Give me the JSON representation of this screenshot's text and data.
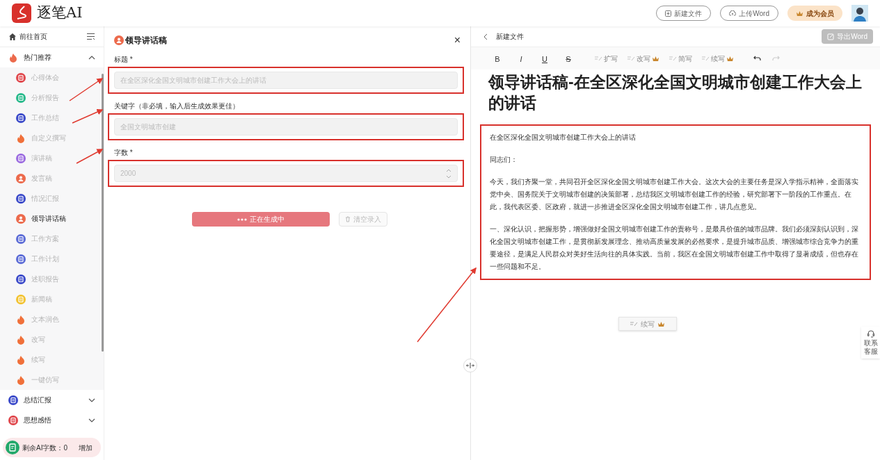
{
  "header": {
    "logo_text": "逐笔AI",
    "buttons": [
      {
        "kind": "new",
        "label": "新建文件"
      },
      {
        "kind": "upload",
        "label": "上传Word"
      }
    ],
    "member_button": "成为会员"
  },
  "sidebar": {
    "home": "前往首页",
    "groups": [
      {
        "label": "热门推荐",
        "kind": "hot",
        "color": "#ec6a4c",
        "expanded": true,
        "items": [
          {
            "label": "心得体会",
            "kind": "doc",
            "color": "#e0474c",
            "selected": false
          },
          {
            "label": "分析报告",
            "kind": "doc",
            "color": "#26b98a",
            "selected": false
          },
          {
            "label": "工作总结",
            "kind": "doc",
            "color": "#3a49c9",
            "selected": false
          },
          {
            "label": "自定义撰写",
            "kind": "hot",
            "color": "#f0703a",
            "selected": false
          },
          {
            "label": "演讲稿",
            "kind": "doc",
            "color": "#9b6be0",
            "selected": false
          },
          {
            "label": "发言稿",
            "kind": "person",
            "color": "#ec6a4c",
            "selected": false
          },
          {
            "label": "情况汇报",
            "kind": "doc",
            "color": "#3a49c9",
            "selected": false
          },
          {
            "label": "领导讲话稿",
            "kind": "person",
            "color": "#ec6a4c",
            "selected": true
          },
          {
            "label": "工作方案",
            "kind": "doc",
            "color": "#5b6bd6",
            "selected": false
          },
          {
            "label": "工作计划",
            "kind": "doc",
            "color": "#5b6bd6",
            "selected": false
          },
          {
            "label": "述职报告",
            "kind": "doc",
            "color": "#3a49c9",
            "selected": false
          },
          {
            "label": "新闻稿",
            "kind": "doc",
            "color": "#f2c230",
            "selected": false
          },
          {
            "label": "文本润色",
            "kind": "hot",
            "color": "#f0703a",
            "selected": false
          },
          {
            "label": "改写",
            "kind": "hot",
            "color": "#f0703a",
            "selected": false
          },
          {
            "label": "续写",
            "kind": "hot",
            "color": "#f0703a",
            "selected": false
          },
          {
            "label": "一键仿写",
            "kind": "hot",
            "color": "#f0703a",
            "selected": false
          }
        ]
      },
      {
        "label": "总结汇报",
        "kind": "doc",
        "color": "#3a49c9",
        "expanded": false
      },
      {
        "label": "思想感悟",
        "kind": "doc",
        "color": "#e0474c",
        "expanded": false
      }
    ],
    "quota": {
      "label": "剩余AI字数：0",
      "action": "增加"
    }
  },
  "form": {
    "title": "领导讲话稿",
    "close": "×",
    "fields": [
      {
        "kind": "text",
        "label": "标题 *",
        "value": "在全区深化全国文明城市创建工作大会上的讲话",
        "disabled": true
      },
      {
        "kind": "text",
        "label": "关键字（非必填，输入后生成效果更佳）",
        "value": "全国文明城市创建",
        "disabled": true
      },
      {
        "kind": "number",
        "label": "字数 *",
        "value": "2000",
        "disabled": true
      }
    ],
    "generate_button": "正在生成中",
    "clear_button": {
      "label": "清空录入",
      "disabled": true
    }
  },
  "editor": {
    "back_label": "新建文件",
    "export_button": {
      "label": "导出Word",
      "disabled": true
    },
    "toolbar": [
      {
        "kind": "format",
        "label": "B",
        "disabled": false
      },
      {
        "kind": "format",
        "label": "I",
        "disabled": false
      },
      {
        "kind": "format",
        "label": "U",
        "disabled": false
      },
      {
        "kind": "format",
        "label": "S",
        "disabled": false
      },
      {
        "kind": "ai",
        "label": "扩写",
        "premium": false,
        "disabled": true
      },
      {
        "kind": "ai",
        "label": "改写",
        "premium": true,
        "disabled": true
      },
      {
        "kind": "ai",
        "label": "简写",
        "premium": false,
        "disabled": true
      },
      {
        "kind": "ai",
        "label": "续写",
        "premium": true,
        "disabled": true
      },
      {
        "kind": "undo",
        "disabled": false
      },
      {
        "kind": "redo",
        "disabled": true
      }
    ],
    "heading": "领导讲话稿-在全区深化全国文明城市创建工作大会上的讲话",
    "paragraphs": [
      "在全区深化全国文明城市创建工作大会上的讲话",
      "同志们：",
      "今天，我们齐聚一堂，共同召开全区深化全国文明城市创建工作大会。这次大会的主要任务是深入学指示精神，全面落实党中央、国务院关于文明城市创建的决策部署，总结我区文明城市创建工作的经验，研究部署下一阶段的工作重点。在此，我代表区委、区政府，就进一步推进全区深化全国文明城市创建工作，讲几点意见。",
      "一、深化认识，把握形势，增强做好全国文明城市创建工作的责称号，是最具价值的城市品牌。我们必须深刻认识到，深化全国文明城市创建工作，是贯彻新发展理念、推动高质量发展的必然要求，是提升城市品质、增强城市综合竞争力的重要途径，是满足人民群众对美好生活向往的具体实践。当前，我区在全国文明城市创建工作中取得了显著成绩，但也存在一些问题和不足。"
    ],
    "floating_button": {
      "label": "续写",
      "premium": true
    }
  },
  "support": "联系客服"
}
